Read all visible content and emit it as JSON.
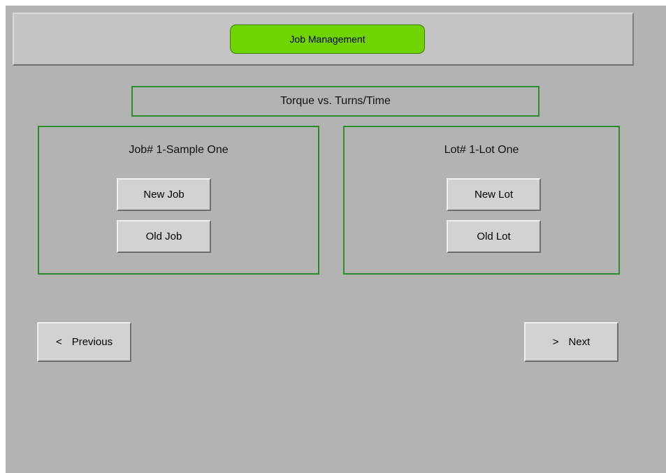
{
  "header": {
    "title": "Job Management"
  },
  "mode": {
    "label": "Torque vs. Turns/Time"
  },
  "job_panel": {
    "label": "Job# 1-Sample One",
    "new_label": "New Job",
    "old_label": "Old Job"
  },
  "lot_panel": {
    "label": "Lot# 1-Lot One",
    "new_label": "New Lot",
    "old_label": "Old Lot"
  },
  "nav": {
    "previous_arrow": "<",
    "previous_label": "Previous",
    "next_arrow": ">",
    "next_label": "Next"
  },
  "colors": {
    "background": "#b3b3b3",
    "title_pill": "#6fd400",
    "panel_border": "#2e8b2e"
  }
}
